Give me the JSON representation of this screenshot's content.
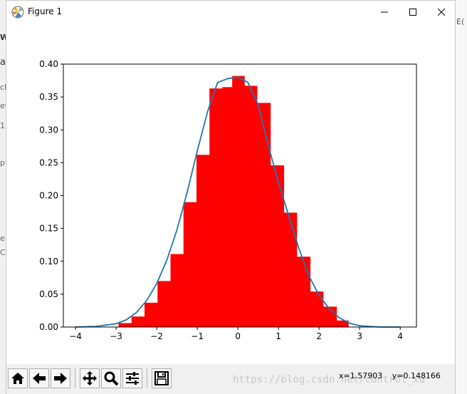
{
  "window": {
    "title": "Figure 1"
  },
  "chart_data": {
    "type": "bar",
    "title": "",
    "xlabel": "",
    "ylabel": "",
    "xlim": [
      -4.3,
      4.4
    ],
    "ylim": [
      0,
      0.4
    ],
    "xticks": [
      "−4",
      "−3",
      "−2",
      "−1",
      "0",
      "1",
      "2",
      "3",
      "4"
    ],
    "xtick_values": [
      -4,
      -3,
      -2,
      -1,
      0,
      1,
      2,
      3,
      4
    ],
    "yticks": [
      "0.00",
      "0.05",
      "0.10",
      "0.15",
      "0.20",
      "0.25",
      "0.30",
      "0.35",
      "0.40"
    ],
    "ytick_values": [
      0,
      0.05,
      0.1,
      0.15,
      0.2,
      0.25,
      0.3,
      0.35,
      0.4
    ],
    "grid": false,
    "bar_color": "#ff0000",
    "line_color": "#1f77b4",
    "histogram": {
      "bin_edges": [
        -2.94,
        -2.62,
        -2.3,
        -1.98,
        -1.66,
        -1.34,
        -1.02,
        -0.7,
        -0.38,
        -0.14,
        0.16,
        0.47,
        0.8,
        1.13,
        1.45,
        1.78,
        2.1,
        2.43,
        2.72
      ],
      "heights": [
        0.006,
        0.016,
        0.037,
        0.07,
        0.111,
        0.19,
        0.262,
        0.363,
        0.365,
        0.382,
        0.367,
        0.341,
        0.246,
        0.174,
        0.107,
        0.054,
        0.031,
        0.01
      ]
    },
    "density_curve": {
      "x": [
        -4,
        -3.5,
        -3,
        -2.75,
        -2.5,
        -2.25,
        -2,
        -1.75,
        -1.5,
        -1.25,
        -1,
        -0.75,
        -0.5,
        -0.25,
        0,
        0.25,
        0.5,
        0.75,
        1,
        1.25,
        1.5,
        1.75,
        2,
        2.25,
        2.5,
        2.75,
        3,
        3.25,
        3.5,
        4
      ],
      "y": [
        0.0,
        0.001,
        0.005,
        0.011,
        0.022,
        0.04,
        0.066,
        0.102,
        0.148,
        0.205,
        0.268,
        0.327,
        0.372,
        0.378,
        0.38,
        0.372,
        0.338,
        0.276,
        0.22,
        0.17,
        0.12,
        0.078,
        0.048,
        0.028,
        0.014,
        0.006,
        0.002,
        0.001,
        0.0,
        0.0
      ]
    }
  },
  "toolbar": {
    "home_icon": "home-icon",
    "back_icon": "arrow-left-icon",
    "forward_icon": "arrow-right-icon",
    "pan_icon": "pan-icon",
    "zoom_icon": "zoom-icon",
    "configure_icon": "sliders-icon",
    "save_icon": "save-icon",
    "coord_x": "x=1.57903",
    "coord_y": "y=0.148166"
  },
  "watermark": "https://blog.csdn.net/control_xu",
  "background": {
    "left_fragments": [
      "W",
      "a",
      "ch",
      "ev",
      "1",
      "py",
      "e",
      "C"
    ],
    "right_fragment": "E("
  }
}
